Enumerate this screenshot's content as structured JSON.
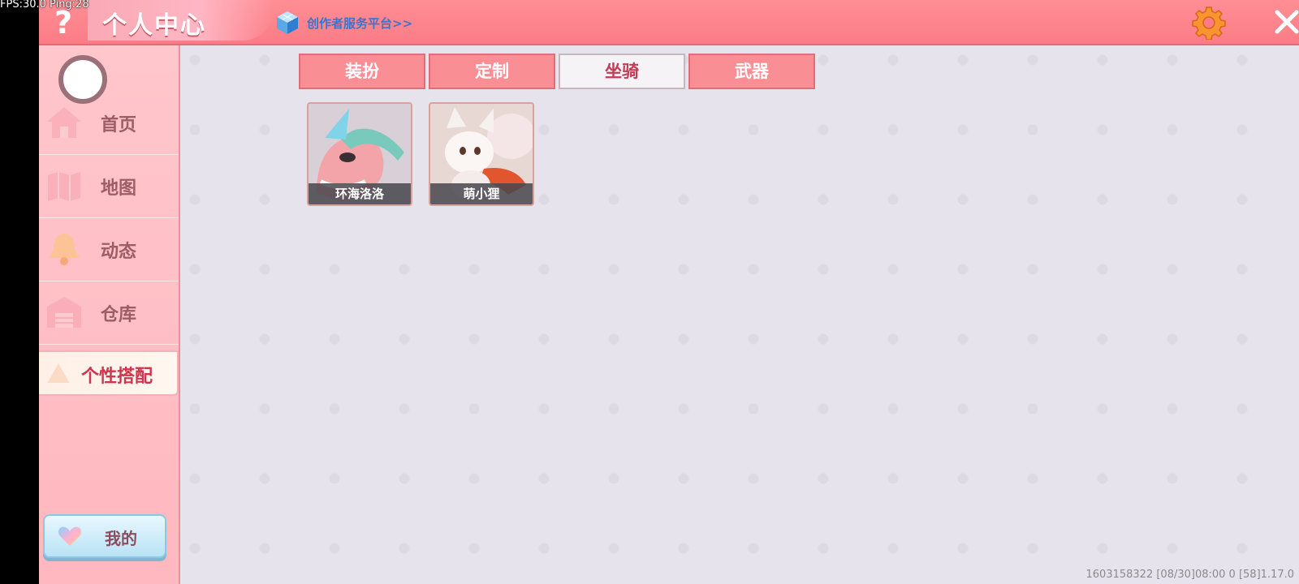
{
  "debug": {
    "text": "FPS:30.0  Ping:28"
  },
  "header": {
    "title": "个人中心",
    "creator_link": "创作者服务平台>>"
  },
  "sidebar": {
    "items": [
      {
        "label": "首页",
        "icon": "home-icon"
      },
      {
        "label": "地图",
        "icon": "map-icon"
      },
      {
        "label": "动态",
        "icon": "bell-icon"
      },
      {
        "label": "仓库",
        "icon": "warehouse-icon"
      }
    ],
    "active_item": {
      "label": "个性搭配"
    },
    "mine_button": "我的"
  },
  "tabs": [
    {
      "label": "装扮",
      "active": false
    },
    {
      "label": "定制",
      "active": false
    },
    {
      "label": "坐骑",
      "active": true
    },
    {
      "label": "武器",
      "active": false
    }
  ],
  "items": [
    {
      "name": "环海洛洛"
    },
    {
      "name": "萌小狸"
    }
  ],
  "footer": {
    "version_info": "1603158322   [08/30]08:00 0  [58]1.17.0"
  },
  "colors": {
    "header": "#fb7c86",
    "tab": "#f98e95",
    "tab_active_text": "#c33b55",
    "sidebar": "#ffc0c6"
  }
}
